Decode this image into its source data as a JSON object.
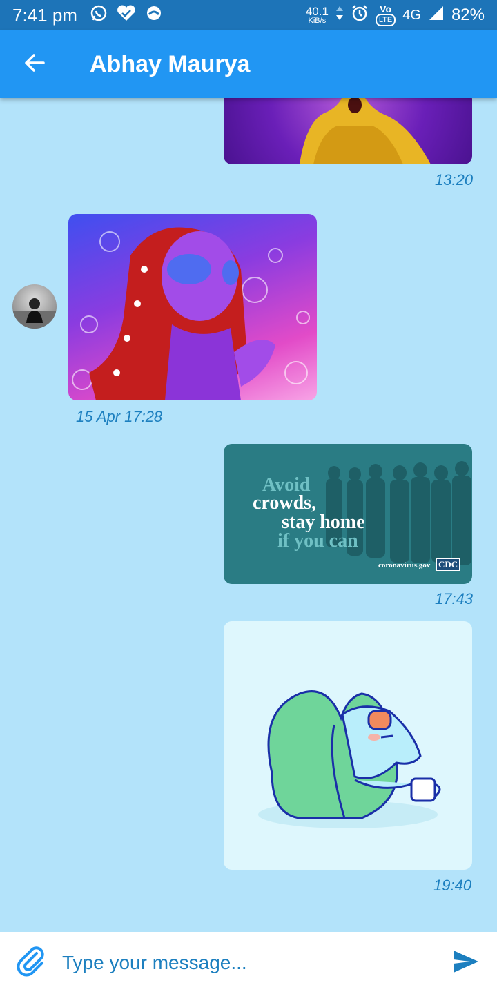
{
  "status_bar": {
    "time": "7:41 pm",
    "net_speed": "40.1",
    "net_unit": "KiB/s",
    "lte_label": "LTE",
    "vo_label": "Vo",
    "network": "4G",
    "battery": "82%"
  },
  "header": {
    "title": "Abhay Maurya"
  },
  "messages": [
    {
      "time": "13:20"
    },
    {
      "time": "15 Apr 17:28"
    },
    {
      "time": "17:43",
      "image_text": {
        "line1": "Avoid",
        "line2": "crowds,",
        "line3": "stay home",
        "line4": "if you can",
        "site": "coronavirus.gov",
        "logo": "CDC"
      }
    },
    {
      "time": "19:40"
    }
  ],
  "composer": {
    "placeholder": "Type your message..."
  },
  "colors": {
    "app_bar": "#2196f3",
    "status_bar": "#1d74b8",
    "chat_bg": "#b3e3fa",
    "accent": "#1c7fbf"
  }
}
